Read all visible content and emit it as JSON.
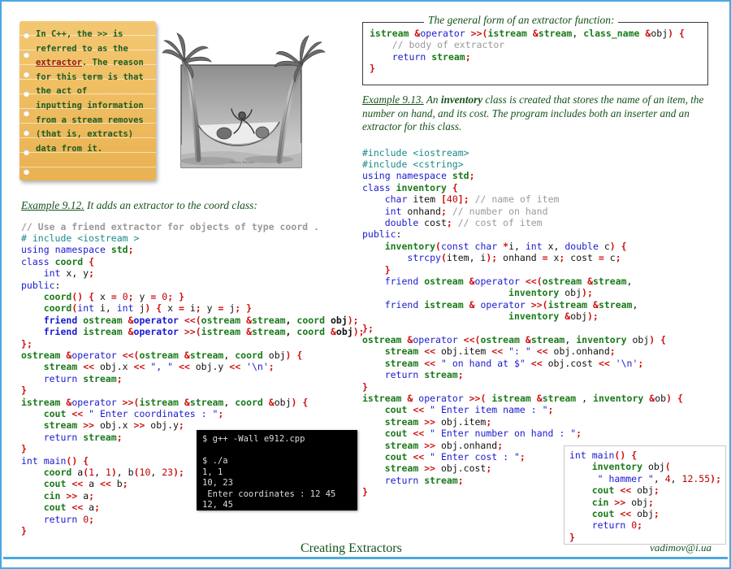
{
  "slide": {
    "footer_title": "Creating Extractors",
    "footer_email": "vadimov@i.ua",
    "accent_color": "#4aa8e0",
    "heading_color": "#14521a"
  },
  "note": {
    "text_before": "In C++, the >> is\nreferred to as the\n",
    "text_underlined": "extractor",
    "text_after": ". The reason\nfor this term is that\nthe act of\ninputting information\nfrom a stream removes\n(that is, extracts)\ndata from it."
  },
  "cartoon": {
    "alt": "pencil drawing of two palm trees with a hammock and a person relaxing",
    "signature": "Charles Barsotti"
  },
  "general_form": {
    "legend": "The general form of an extractor function:",
    "code": "istream &operator >>(istream &stream, class_name &obj) {\n    // body of extractor\n    return stream;\n}"
  },
  "example_912": {
    "label": "Example 9.12.",
    "caption": " It adds an extractor to the coord class:",
    "code": "// Use a friend extractor for objects of type coord .\n# include <iostream >\nusing namespace std;\nclass coord {\n    int x, y;\npublic:\n    coord() { x = 0; y = 0; }\n    coord(int i, int j) { x = i; y = j; }\n    friend ostream &operator <<(ostream &stream, coord obj);\n    friend istream &operator >>(istream &stream, coord &obj);\n};\nostream &operator <<(ostream &stream, coord obj) {\n    stream << obj.x << \", \" << obj.y << '\\n';\n    return stream;\n}\nistream &operator >>(istream &stream, coord &obj) {\n    cout << \" Enter coordinates : \";\n    stream >> obj.x >> obj.y;\n    return stream;\n}\nint main() {\n    coord a(1, 1), b(10, 23);\n    cout << a << b;\n    cin >> a;\n    cout << a;\n    return 0;\n}"
  },
  "terminal": {
    "lines": [
      "$ g++ -Wall e912.cpp",
      "",
      "$ ./a",
      "1, 1",
      "10, 23",
      " Enter coordinates : 12 45",
      "12, 45"
    ]
  },
  "example_913": {
    "label": "Example 9.13.",
    "caption_part1": " An ",
    "caption_bold": "inventory",
    "caption_part2": " class is created that stores the name of an item, the number on hand, and its cost. The program includes both an inserter and an extractor for this class.",
    "code": "#include <iostream>\n#include <cstring>\nusing namespace std;\nclass inventory {\n    char item [40]; // name of item\n    int onhand; // number on hand\n    double cost; // cost of item\npublic:\n    inventory(const char *i, int x, double c) {\n        strcpy(item, i); onhand = x; cost = c;\n    }\n    friend ostream &operator <<(ostream &stream,\n                          inventory obj);\n    friend istream & operator >>(istream &stream,\n                          inventory &obj);\n};\nostream &operator <<(ostream &stream, inventory obj) {\n    stream << obj.item << \": \" << obj.onhand;\n    stream << \" on hand at $\" << obj.cost << '\\n';\n    return stream;\n}\nistream & operator >>( istream &stream , inventory &ob) {\n    cout << \" Enter item name : \";\n    stream >> obj.item;\n    cout << \" Enter number on hand : \";\n    stream >> obj.onhand;\n    cout << \" Enter cost : \";\n    stream >> obj.cost;\n    return stream;\n}"
  },
  "main_box": {
    "code": "int main() {\n    inventory obj(\n     \" hammer \", 4, 12.55);\n    cout << obj;\n    cin >> obj;\n    cout << obj;\n    return 0;\n}"
  }
}
